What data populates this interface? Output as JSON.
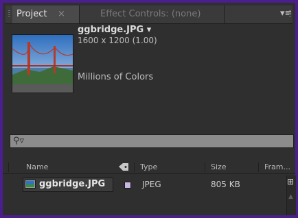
{
  "tabs": {
    "project_label": "Project",
    "close_glyph": "×",
    "effect_controls_label": "Effect Controls: (none)",
    "panel_menu_glyph": "▾≡"
  },
  "preview": {
    "filename": "ggbridge.JPG ▾",
    "dimensions": "1600 x 1200 (1.00)",
    "color_depth": "Millions of Colors"
  },
  "search": {
    "icon_glyph": "⚲▿",
    "value": ""
  },
  "columns": {
    "name": "Name",
    "tag_icon": "label-tag-icon",
    "type": "Type",
    "size": "Size",
    "frame": "Fram..."
  },
  "items": [
    {
      "name": "ggbridge.JPG",
      "type": "JPEG",
      "size": "805 KB",
      "label_color": "#c7b6e0"
    }
  ],
  "colors": {
    "panel_border": "#4b1e8e",
    "panel_bg": "#2f2f2f",
    "search_bg": "#8c8c8c"
  }
}
